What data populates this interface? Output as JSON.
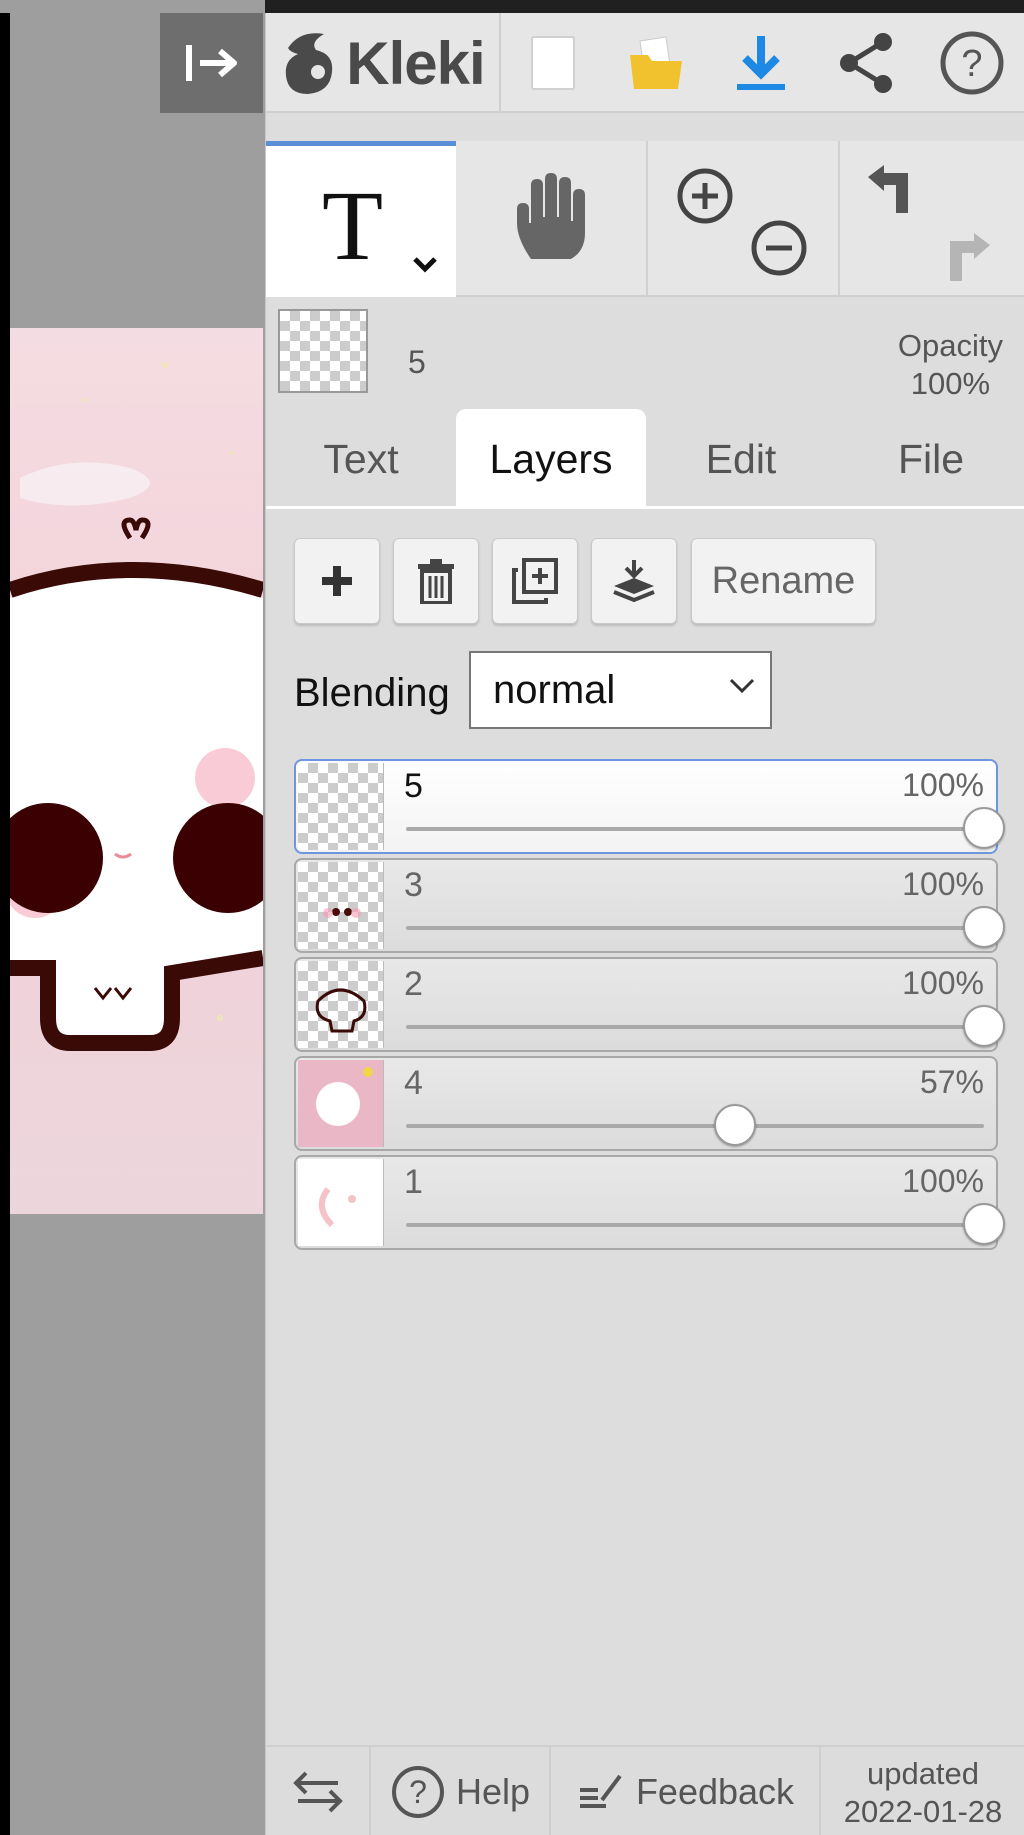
{
  "app": {
    "name": "Kleki"
  },
  "toolbar": {
    "new_label": "",
    "icons": [
      "collapse-panel-icon",
      "kleki-logo",
      "new-file-icon",
      "open-folder-icon",
      "download-icon",
      "share-icon",
      "help-icon"
    ]
  },
  "tools": {
    "active": "text",
    "text_glyph": "T",
    "items": [
      "text-tool",
      "hand-tool",
      "zoom-in",
      "zoom-out",
      "undo",
      "redo"
    ]
  },
  "current_layer": {
    "name": "5",
    "opacity_label": "Opacity",
    "opacity_value": "100%"
  },
  "tabs": [
    {
      "label": "Text",
      "active": false
    },
    {
      "label": "Layers",
      "active": true
    },
    {
      "label": "Edit",
      "active": false
    },
    {
      "label": "File",
      "active": false
    }
  ],
  "layer_actions": {
    "rename_label": "Rename",
    "icons": [
      "add-layer-icon",
      "delete-layer-icon",
      "duplicate-layer-icon",
      "merge-down-icon"
    ]
  },
  "blending": {
    "label": "Blending",
    "value": "normal"
  },
  "layers": [
    {
      "name": "5",
      "opacity_label": "100%",
      "opacity": 1.0,
      "selected": true,
      "thumb": "empty"
    },
    {
      "name": "3",
      "opacity_label": "100%",
      "opacity": 1.0,
      "selected": false,
      "thumb": "eyes"
    },
    {
      "name": "2",
      "opacity_label": "100%",
      "opacity": 1.0,
      "selected": false,
      "thumb": "outline"
    },
    {
      "name": "4",
      "opacity_label": "57%",
      "opacity": 0.57,
      "selected": false,
      "thumb": "background"
    },
    {
      "name": "1",
      "opacity_label": "100%",
      "opacity": 1.0,
      "selected": false,
      "thumb": "white"
    }
  ],
  "footer": {
    "help_label": "Help",
    "feedback_label": "Feedback",
    "updated_label": "updated",
    "updated_date": "2022-01-28"
  },
  "colors": {
    "accent": "#5a8fd8",
    "download": "#1e88e5",
    "folder": "#f2c12e",
    "panel_bg": "#dddddd"
  }
}
